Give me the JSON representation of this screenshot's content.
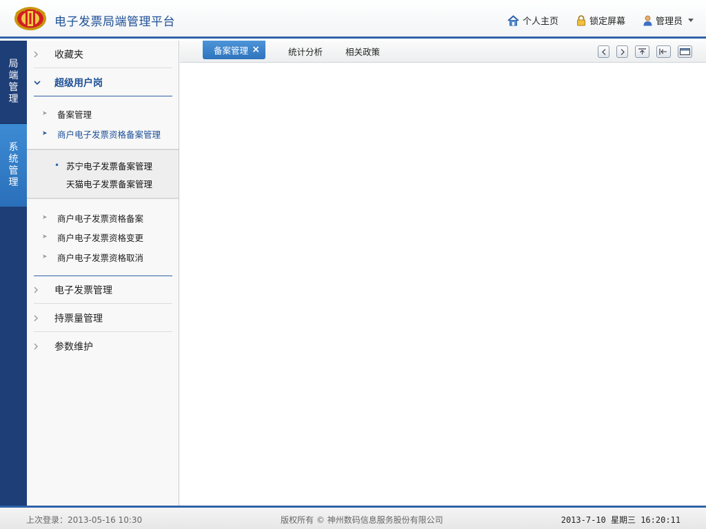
{
  "header": {
    "title": "电子发票局端管理平台",
    "links": {
      "home": "个人主页",
      "lock": "锁定屏幕",
      "user": "管理员"
    }
  },
  "vnav": {
    "items": [
      {
        "label": "局端管理",
        "chars": [
          "局",
          "端",
          "管",
          "理"
        ]
      },
      {
        "label": "系统管理",
        "chars": [
          "系",
          "统",
          "管",
          "理"
        ]
      }
    ]
  },
  "sidebar": {
    "groups": {
      "favorites": "收藏夹",
      "super_user": "超级用户岗",
      "einvoice": "电子发票管理",
      "ticket_qty": "持票量管理",
      "params": "参数维护"
    },
    "sub_items": {
      "record_mgmt": "备案管理",
      "merchant_record_mgmt": "商户电子发票资格备案管理",
      "merchant_record": "商户电子发票资格备案",
      "merchant_change": "商户电子发票资格变更",
      "merchant_cancel": "商户电子发票资格取消"
    },
    "third_items": {
      "suning": "苏宁电子发票备案管理",
      "tmall": "天猫电子发票备案管理"
    }
  },
  "tabs": {
    "active": "备案管理",
    "close": "×",
    "stats": "统计分析",
    "policy": "相关政策"
  },
  "footer": {
    "last_login": "上次登录：2013-05-16 10:30",
    "copyright": "版权所有 © 神州数码信息服务股份有限公司",
    "datetime": "2013-7-10  星期三  16:20:11"
  },
  "colors": {
    "brand_blue": "#2d62a8",
    "nav_dark": "#1e3e77",
    "nav_active": "#3d8bd4",
    "title_blue": "#1d4f96"
  }
}
